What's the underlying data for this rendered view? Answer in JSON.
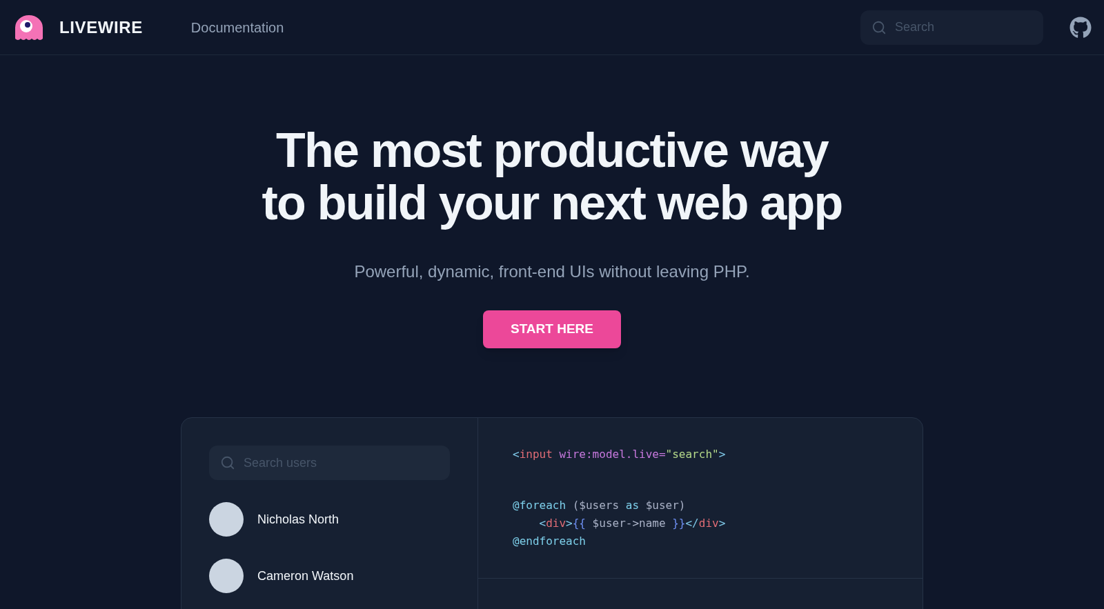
{
  "nav": {
    "brand": "LIVEWIRE",
    "links": [
      "Documentation"
    ],
    "search": {
      "placeholder": "Search"
    }
  },
  "hero": {
    "title_lines": [
      "The most productive way",
      "to build your next web app"
    ],
    "subtitle": "Powerful, dynamic, front-end UIs without leaving PHP.",
    "cta": "START HERE"
  },
  "demo": {
    "search": {
      "placeholder": "Search users"
    },
    "users": [
      {
        "name": "Nicholas North"
      },
      {
        "name": "Cameron Watson"
      }
    ],
    "code_blocks": [
      [
        [
          {
            "text": "<",
            "kind": "punct"
          },
          {
            "text": "input",
            "kind": "tag"
          },
          {
            "text": " wire:model.live=",
            "kind": "attr"
          },
          {
            "text": "\"search\"",
            "kind": "string"
          },
          {
            "text": ">",
            "kind": "punct"
          }
        ]
      ],
      [
        [
          {
            "text": "@foreach",
            "kind": "directive"
          },
          {
            "text": " ($users ",
            "kind": "var"
          },
          {
            "text": "as",
            "kind": "directive"
          },
          {
            "text": " $user)",
            "kind": "var"
          }
        ],
        [
          {
            "text": "    <",
            "kind": "punct"
          },
          {
            "text": "div",
            "kind": "tag"
          },
          {
            "text": ">",
            "kind": "punct"
          },
          {
            "text": "{{",
            "kind": "brace"
          },
          {
            "text": " $user->name ",
            "kind": "var"
          },
          {
            "text": "}}",
            "kind": "brace"
          },
          {
            "text": "</",
            "kind": "punct"
          },
          {
            "text": "div",
            "kind": "tag"
          },
          {
            "text": ">",
            "kind": "punct"
          }
        ],
        [
          {
            "text": "@endforeach",
            "kind": "directive"
          }
        ]
      ]
    ]
  }
}
